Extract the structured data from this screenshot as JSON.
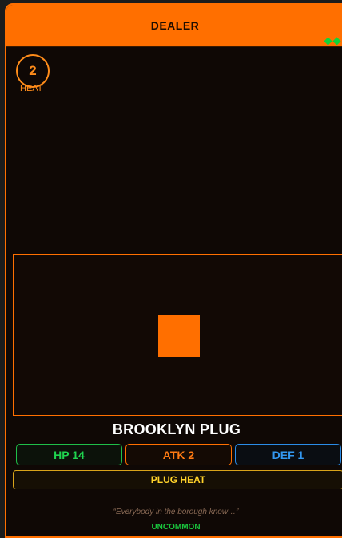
{
  "card": {
    "type_label": "DEALER",
    "cost": "2",
    "cost_label": "HEAT",
    "name": "BROOKLYN PLUG",
    "stats": {
      "hp": "HP 14",
      "atk": "ATK 2",
      "def": "DEF 1"
    },
    "ability": "PLUG HEAT",
    "flavor": "“Everybody in the borough know…”",
    "rarity": "UNCOMMON",
    "gems": 2,
    "colors": {
      "accent": "#ff6f00",
      "hp": "#1fd44f",
      "atk": "#ff7a12",
      "def": "#3397f0",
      "ability": "#ffd22a",
      "rarity": "#19c43d"
    }
  }
}
